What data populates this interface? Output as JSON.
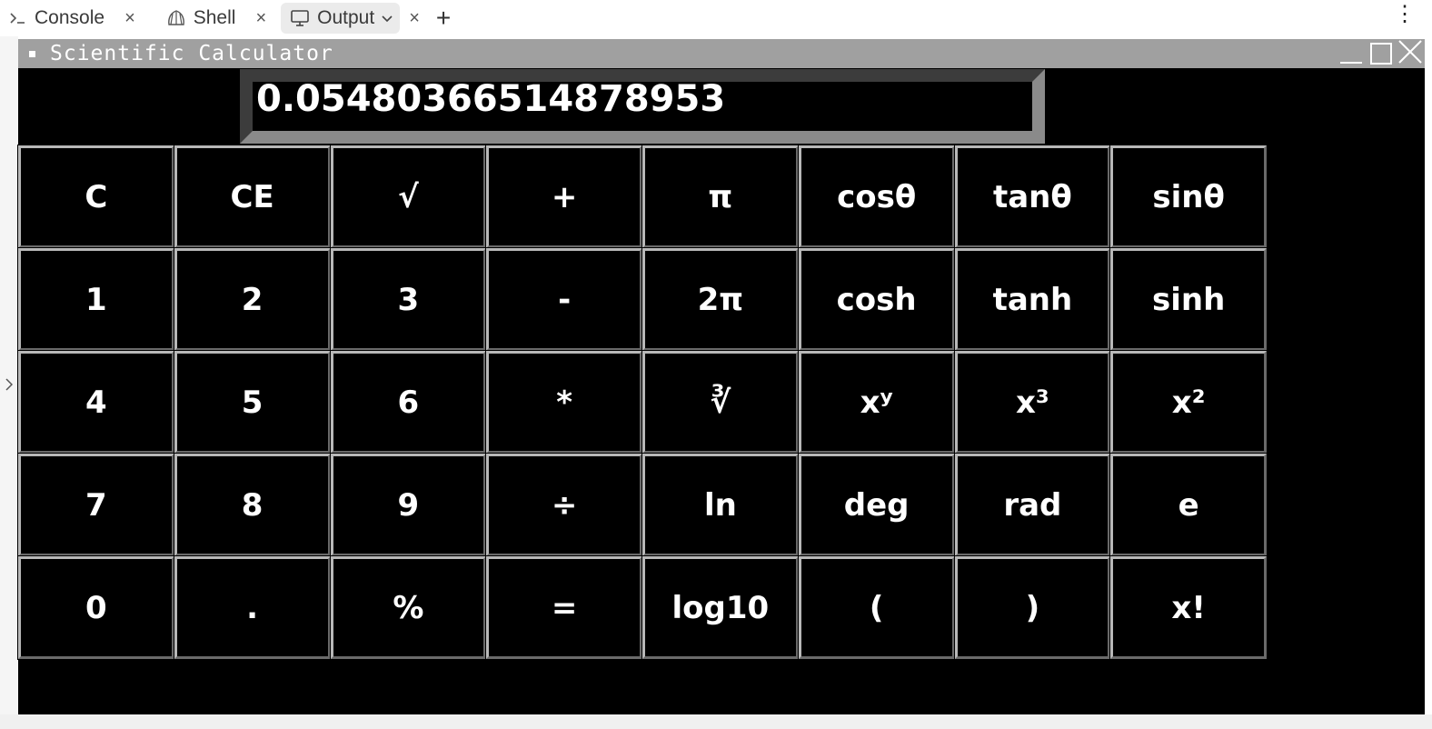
{
  "tabs": [
    {
      "icon": "terminal-icon",
      "label": "Console",
      "close": "×"
    },
    {
      "icon": "shell-icon",
      "label": "Shell",
      "close": "×"
    },
    {
      "icon": "monitor-icon",
      "label": "Output",
      "chevron": "⌄",
      "close": "×"
    }
  ],
  "tabbar": {
    "add_label": "+",
    "menu_label": "⋮"
  },
  "window": {
    "title": "Scientific Calculator",
    "close_label": "╳"
  },
  "display": {
    "value": "0.05480366514878953"
  },
  "keypad": {
    "rows": [
      [
        "C",
        "CE",
        "√",
        "+",
        "π",
        "cosθ",
        "tanθ",
        "sinθ"
      ],
      [
        "1",
        "2",
        "3",
        "-",
        "2π",
        "cosh",
        "tanh",
        "sinh"
      ],
      [
        "4",
        "5",
        "6",
        "*",
        "∛",
        "xʸ",
        "x³",
        "x²"
      ],
      [
        "7",
        "8",
        "9",
        "÷",
        "ln",
        "deg",
        "rad",
        "e"
      ],
      [
        "0",
        ".",
        "%",
        "=",
        "log10",
        "(",
        ")",
        "x!"
      ]
    ]
  },
  "colors": {
    "window_bg": "#000000",
    "titlebar_bg": "#a0a0a0",
    "text": "#ffffff"
  }
}
